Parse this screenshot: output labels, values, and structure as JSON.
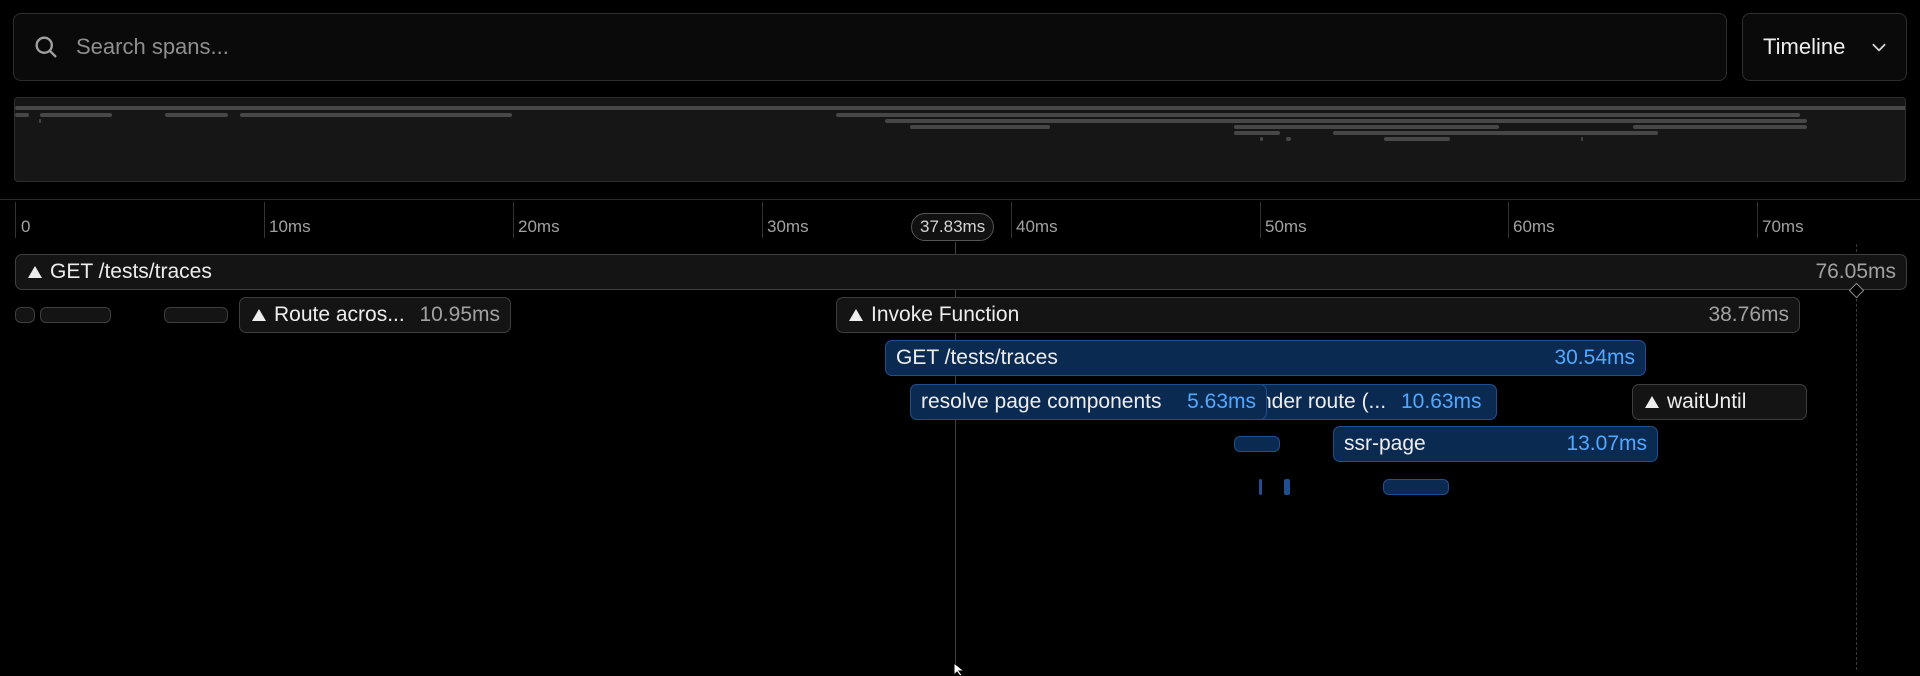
{
  "search": {
    "placeholder": "Search spans..."
  },
  "view_select": {
    "value": "Timeline"
  },
  "ruler": {
    "ticks": [
      "0",
      "10ms",
      "20ms",
      "30ms",
      "40ms",
      "50ms",
      "60ms",
      "70ms"
    ],
    "cursor": "37.83ms"
  },
  "spans": {
    "root": {
      "name": "GET /tests/traces",
      "duration": "76.05ms"
    },
    "route": {
      "name": "Route acros...",
      "duration": "10.95ms"
    },
    "invoke": {
      "name": "Invoke Function",
      "duration": "38.76ms"
    },
    "get_inner": {
      "name": "GET /tests/traces",
      "duration": "30.54ms"
    },
    "resolve": {
      "name": "resolve page components",
      "duration": "5.63ms"
    },
    "render_route": {
      "name": "nder route (...",
      "duration": "10.63ms"
    },
    "wait_until": {
      "name": "waitUntil"
    },
    "ssr_page": {
      "name": "ssr-page",
      "duration": "13.07ms"
    }
  },
  "colors": {
    "background": "#000000",
    "span_blue": "#0b2a52",
    "duration_blue": "#52a8ff",
    "border_gray": "#3e3e3e"
  },
  "icons": {
    "search": "search-icon",
    "chevron": "chevron-down-icon",
    "span_marker": "triangle-up-icon"
  }
}
